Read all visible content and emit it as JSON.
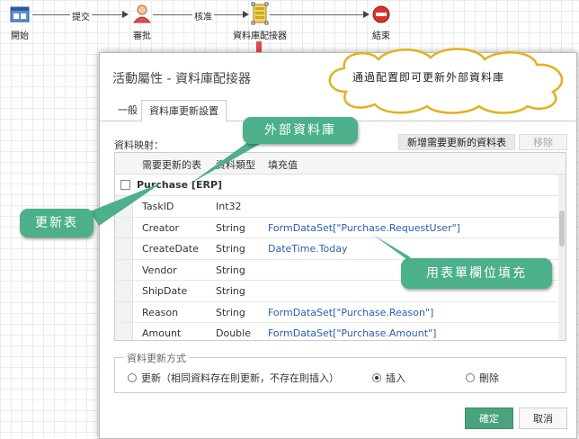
{
  "workflow": {
    "nodes": [
      {
        "label": "開始",
        "icon": "start-icon"
      },
      {
        "label": "審批",
        "icon": "user-icon"
      },
      {
        "label": "資料庫配接器",
        "icon": "database-adapter-icon"
      },
      {
        "label": "結束",
        "icon": "stop-icon"
      }
    ],
    "edges": [
      {
        "label": "提交"
      },
      {
        "label": "核准"
      }
    ]
  },
  "dialog": {
    "title": "活動屬性 - 資料庫配接器",
    "tabs": [
      {
        "label": "一般"
      },
      {
        "label": "資料庫更新設置",
        "active": true
      }
    ],
    "mapping_label": "資料映射：",
    "add_table_button": "新增需要更新的資料表",
    "remove_button": "移除",
    "grid": {
      "columns": [
        "需要更新的表",
        "資料類型",
        "填充值"
      ],
      "group": "Purchase [ERP]",
      "rows": [
        {
          "field": "TaskID",
          "type": "Int32",
          "value": ""
        },
        {
          "field": "Creator",
          "type": "String",
          "value": "FormDataSet[\"Purchase.RequestUser\"]"
        },
        {
          "field": "CreateDate",
          "type": "String",
          "value": "DateTime.Today"
        },
        {
          "field": "Vendor",
          "type": "String",
          "value": ""
        },
        {
          "field": "ShipDate",
          "type": "String",
          "value": ""
        },
        {
          "field": "Reason",
          "type": "String",
          "value": "FormDataSet[\"Purchase.Reason\"]"
        },
        {
          "field": "Amount",
          "type": "Double",
          "value": "FormDataSet[\"Purchase.Amount\"]"
        }
      ]
    },
    "update_mode": {
      "legend": "資料更新方式",
      "options": [
        {
          "label": "更新（相同資料存在則更新，不存在則插入）",
          "selected": false
        },
        {
          "label": "插入",
          "selected": true
        },
        {
          "label": "刪除",
          "selected": false
        }
      ]
    },
    "ok_button": "確定",
    "cancel_button": "取消"
  },
  "callouts": {
    "cloud": "通過配置即可更新外部資料庫",
    "external_db": "外部資料庫",
    "update_table": "更新表",
    "fill_with_form": "用表單欄位填充"
  },
  "colors": {
    "callout": "#4cb08a",
    "ok_button": "#4aa37c",
    "arrow": "#e84a4a"
  }
}
